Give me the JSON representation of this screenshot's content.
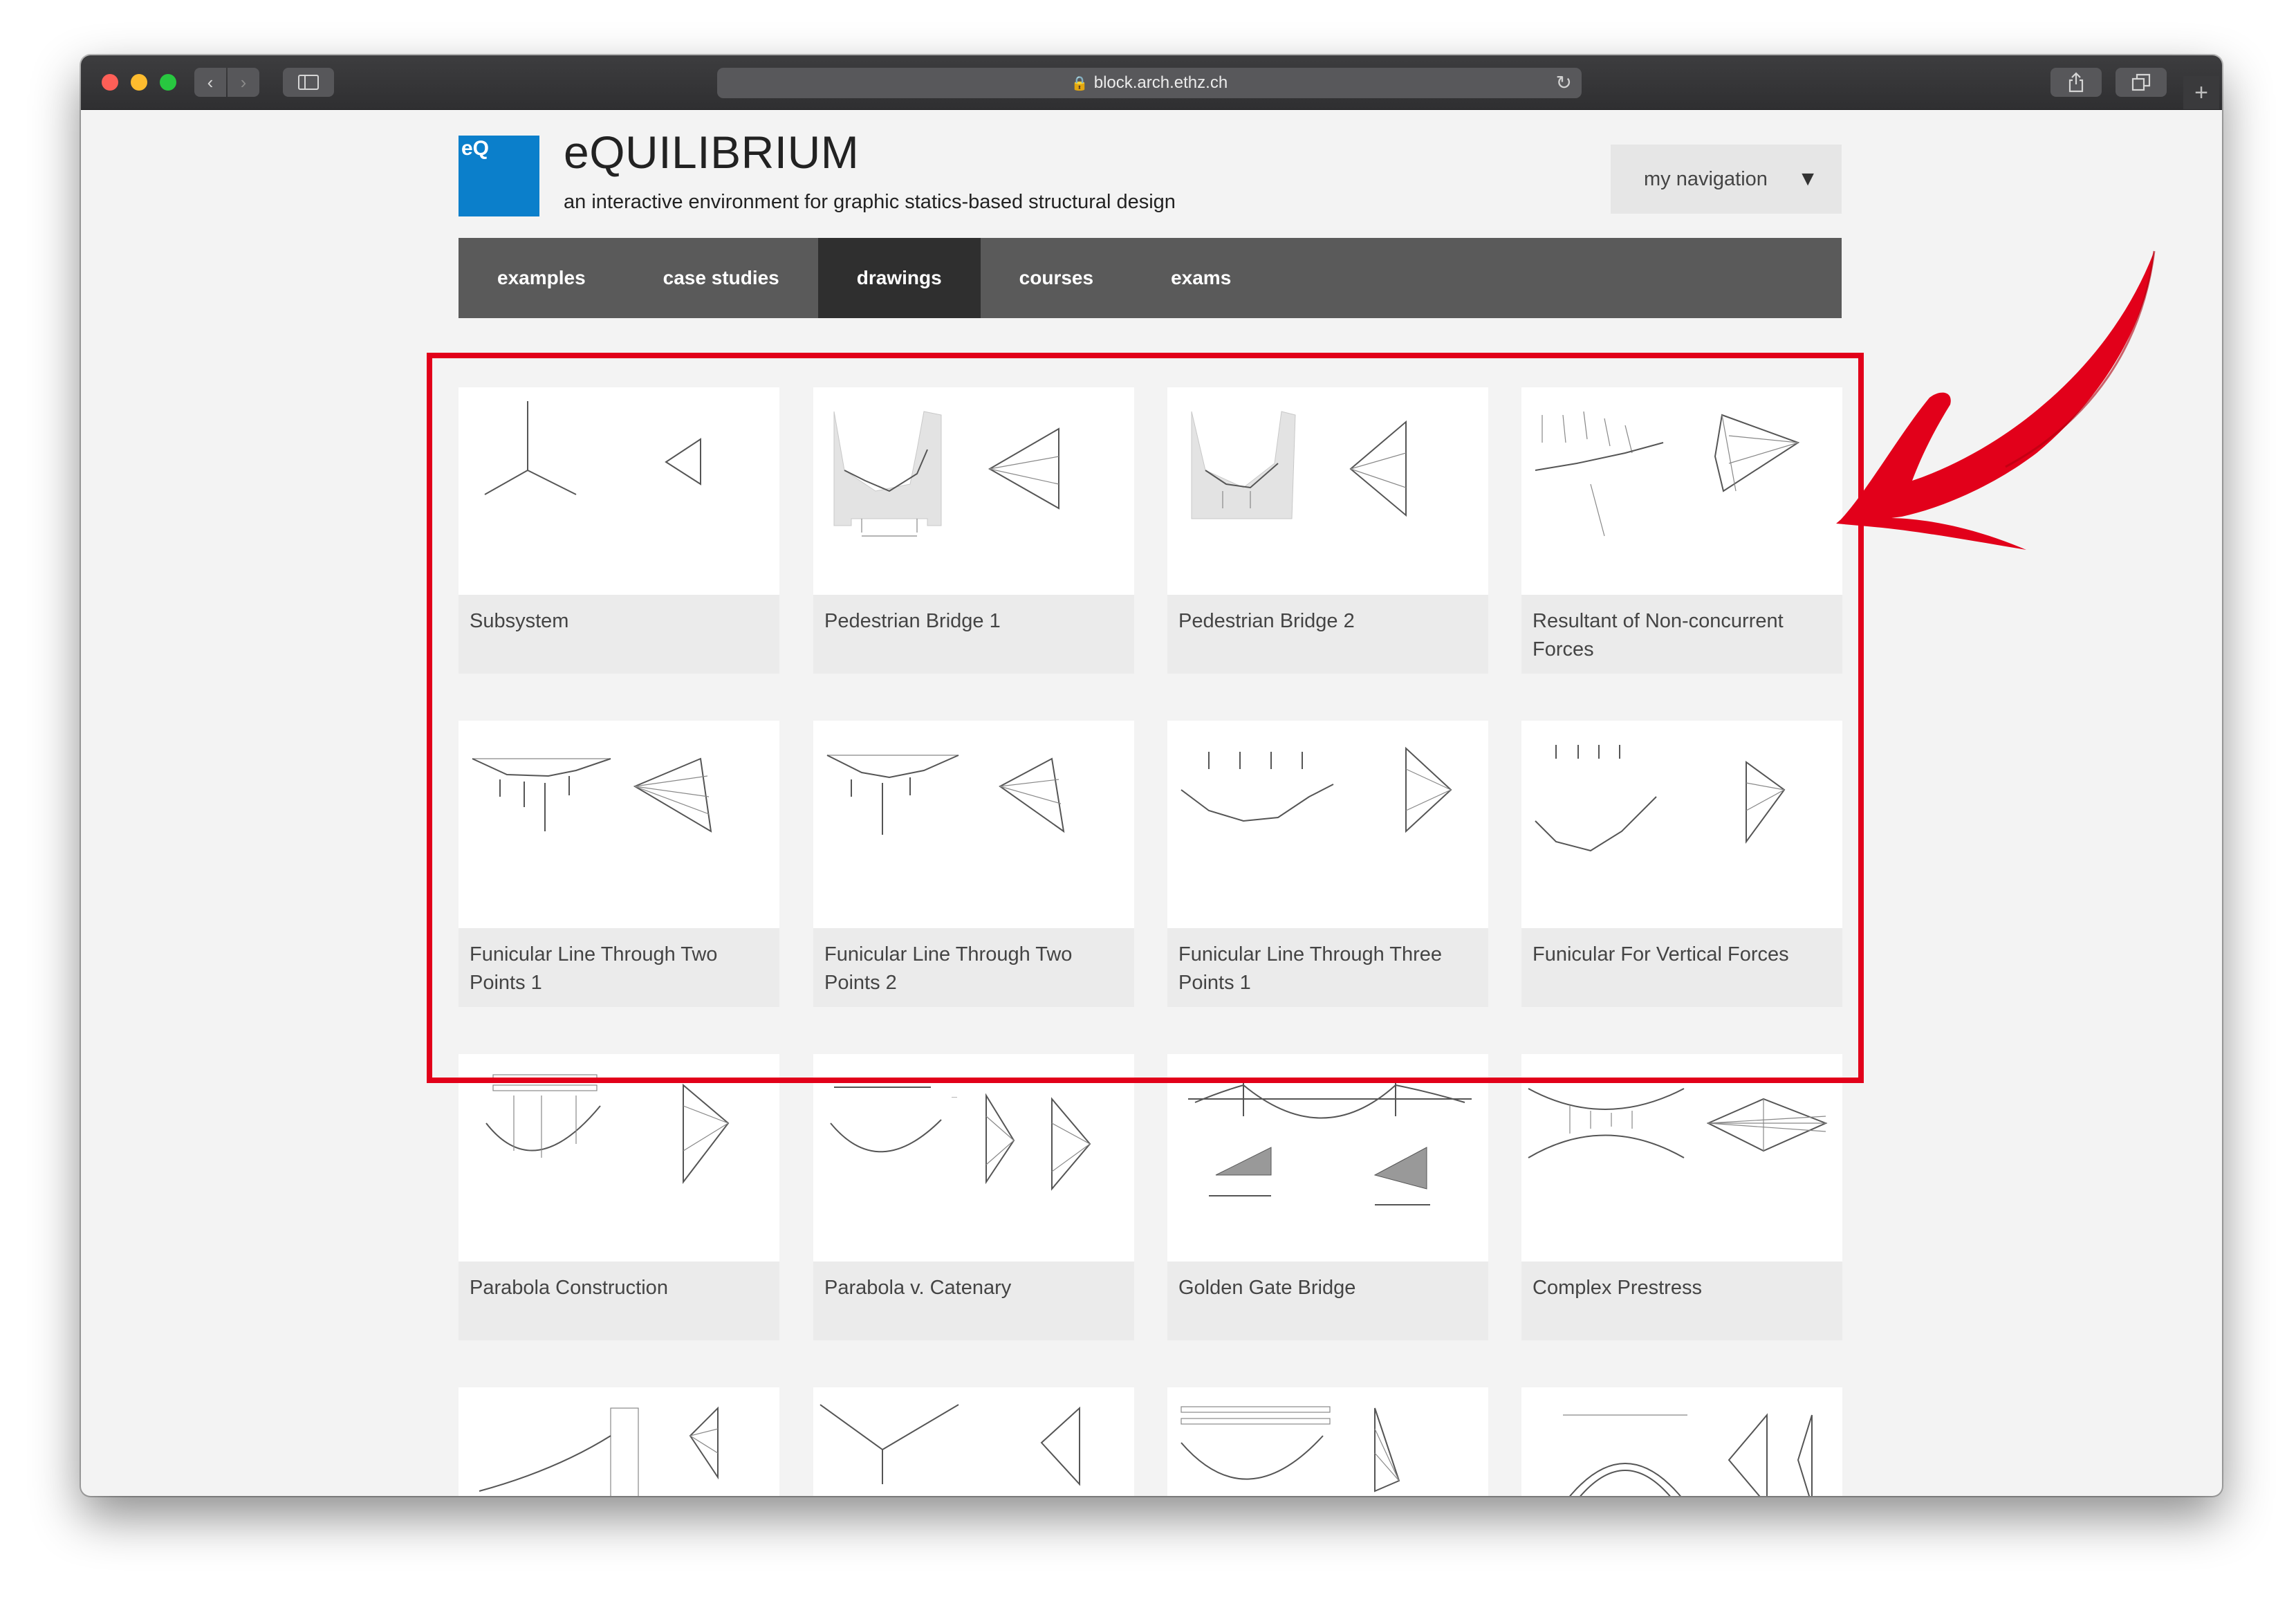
{
  "browser": {
    "url": "block.arch.ethz.ch",
    "buttons": {
      "back": "back",
      "forward": "forward",
      "sidebar": "sidebar",
      "share": "share",
      "tabs": "tabs",
      "new_tab": "+"
    }
  },
  "header": {
    "logo_text": "eQ",
    "title": "eQUILIBRIUM",
    "subtitle": "an interactive environment for graphic statics-based structural design",
    "my_navigation": "my navigation",
    "my_navigation_caret": "▼"
  },
  "nav": {
    "items": [
      {
        "label": "examples"
      },
      {
        "label": "case studies"
      },
      {
        "label": "drawings",
        "active": true
      },
      {
        "label": "courses"
      },
      {
        "label": "exams"
      }
    ]
  },
  "gallery": {
    "cards": [
      {
        "title": "Subsystem",
        "icon": "subsystem-drawing"
      },
      {
        "title": "Pedestrian Bridge 1",
        "icon": "bridge-drawing"
      },
      {
        "title": "Pedestrian Bridge 2",
        "icon": "bridge-drawing"
      },
      {
        "title": "Resultant of Non-concurrent Forces",
        "icon": "resultant-drawing"
      },
      {
        "title": "Funicular Line Through Two Points 1",
        "icon": "funicular-drawing"
      },
      {
        "title": "Funicular Line Through Two Points 2",
        "icon": "funicular-drawing"
      },
      {
        "title": "Funicular Line Through Three Points 1",
        "icon": "funicular-drawing"
      },
      {
        "title": "Funicular For Vertical Forces",
        "icon": "funicular-drawing"
      },
      {
        "title": "Parabola Construction",
        "icon": "parabola-drawing"
      },
      {
        "title": "Parabola v. Catenary",
        "icon": "catenary-drawing"
      },
      {
        "title": "Golden Gate Bridge",
        "icon": "suspension-bridge-drawing"
      },
      {
        "title": "Complex Prestress",
        "icon": "prestress-drawing"
      },
      {
        "title": "",
        "icon": "tower-bridge-drawing"
      },
      {
        "title": "",
        "icon": "cable-drawing"
      },
      {
        "title": "",
        "icon": "hanging-cable-drawing"
      },
      {
        "title": "",
        "icon": "arch-drawing"
      }
    ]
  },
  "annotation": {
    "highlight_color": "#e2001a"
  }
}
